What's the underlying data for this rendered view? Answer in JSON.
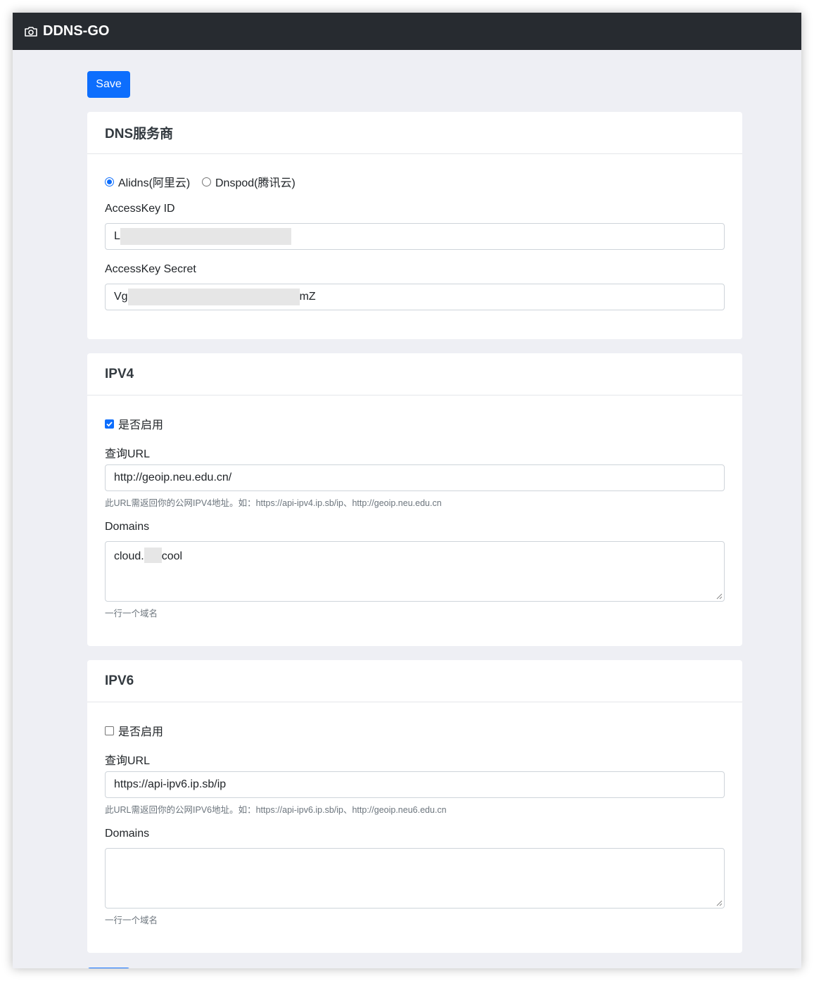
{
  "app": {
    "title": "DDNS-GO"
  },
  "toolbar": {
    "save_label": "Save"
  },
  "dns": {
    "header": "DNS服务商",
    "options": [
      "Alidns(阿里云)",
      "Dnspod(腾讯云)"
    ],
    "selected": "Alidns(阿里云)",
    "access_key_id_label": "AccessKey ID",
    "access_key_id_prefix": "L",
    "access_key_secret_label": "AccessKey Secret",
    "access_key_secret_prefix": "Vg",
    "access_key_secret_suffix": "mZ"
  },
  "ipv4": {
    "header": "IPV4",
    "enable_label": "是否启用",
    "enabled": true,
    "url_label": "查询URL",
    "url_value": "http://geoip.neu.edu.cn/",
    "url_help": "此URL需返回你的公网IPV4地址。如：https://api-ipv4.ip.sb/ip、http://geoip.neu.edu.cn",
    "domains_label": "Domains",
    "domains_prefix": "cloud.",
    "domains_suffix": "cool",
    "domains_help": "一行一个域名"
  },
  "ipv6": {
    "header": "IPV6",
    "enable_label": "是否启用",
    "enabled": false,
    "url_label": "查询URL",
    "url_value": "https://api-ipv6.ip.sb/ip",
    "url_help": "此URL需返回你的公网IPV6地址。如：https://api-ipv6.ip.sb/ip、http://geoip.neu6.edu.cn",
    "domains_label": "Domains",
    "domains_value": "",
    "domains_help": "一行一个域名"
  },
  "colors": {
    "navbar": "#272b30",
    "accent": "#0d6efd",
    "background": "#eeeff4"
  }
}
